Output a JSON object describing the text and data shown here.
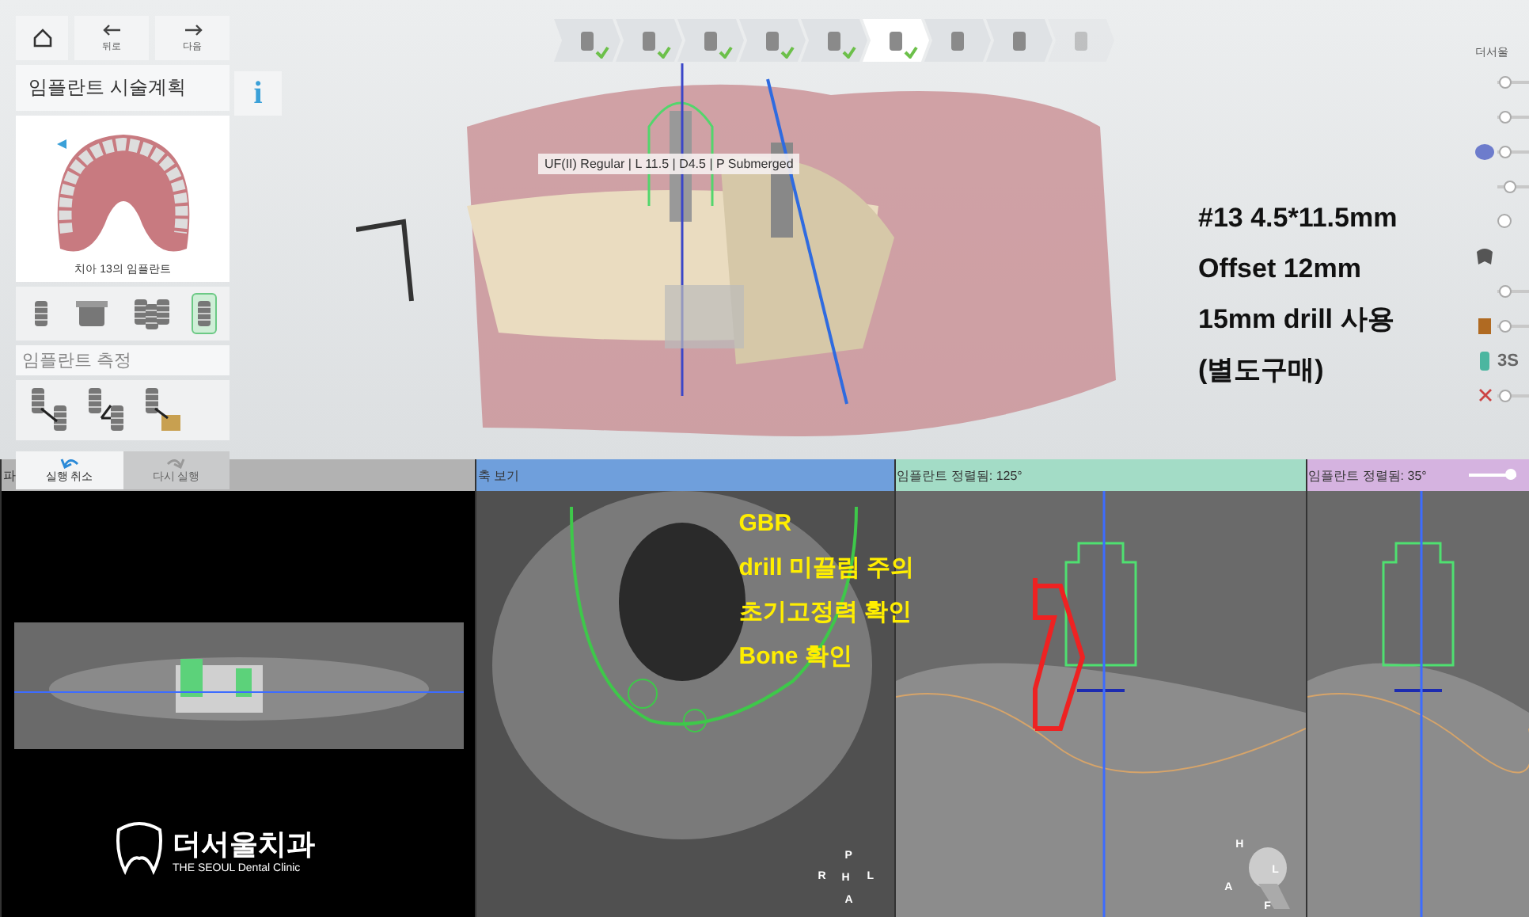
{
  "nav": {
    "back": "뒤로",
    "next": "다음",
    "info": "i"
  },
  "plan_panel": {
    "title": "임플란트 시술계획",
    "caption": "치아 13의 임플란트",
    "tools": [
      {
        "kind": "implant",
        "selected": false
      },
      {
        "kind": "cylinder",
        "selected": false
      },
      {
        "kind": "multi",
        "selected": false
      },
      {
        "kind": "implant",
        "selected": true
      }
    ],
    "measure_title": "임플란트 측정",
    "measures": [
      {
        "kind": "distance"
      },
      {
        "kind": "angle"
      },
      {
        "kind": "bone"
      }
    ],
    "undo": {
      "label": "실행 취소",
      "disabled": false
    },
    "redo": {
      "label": "다시 실행",
      "disabled": true
    }
  },
  "steps": [
    {
      "checked": true,
      "selected": false,
      "disabled": false
    },
    {
      "checked": true,
      "selected": false,
      "disabled": false
    },
    {
      "checked": true,
      "selected": false,
      "disabled": false
    },
    {
      "checked": true,
      "selected": false,
      "disabled": false
    },
    {
      "checked": true,
      "selected": false,
      "disabled": false
    },
    {
      "checked": true,
      "selected": true,
      "disabled": false
    },
    {
      "checked": false,
      "selected": false,
      "disabled": false
    },
    {
      "checked": false,
      "selected": false,
      "disabled": false
    },
    {
      "checked": false,
      "selected": false,
      "disabled": true
    }
  ],
  "tooltip": "UF(II) Regular | L 11.5 | D4.5 | P Submerged",
  "notes": [
    "#13 4.5*11.5mm",
    "Offset 12mm",
    "15mm drill 사용",
    "(별도구매)"
  ],
  "layers_panel": {
    "title": "더서울",
    "badge": "3S",
    "layers": [
      {
        "kind": "slider",
        "level": 0.05
      },
      {
        "kind": "slider",
        "level": 0.05
      },
      {
        "kind": "slider",
        "level": 0.05
      },
      {
        "kind": "slider",
        "level": 0.3
      },
      {
        "kind": "toggle"
      },
      {
        "kind": "toggle"
      },
      {
        "kind": "slider",
        "level": 0.05
      },
      {
        "kind": "slider",
        "level": 0.05
      },
      {
        "kind": "toggle"
      },
      {
        "kind": "slider",
        "level": 0.05
      }
    ]
  },
  "views": [
    {
      "kind": "panoramic",
      "title": "파",
      "color": "#b2b2b2"
    },
    {
      "kind": "axial",
      "title": "축 보기",
      "color": "#6f9fdc",
      "notes": [
        "GBR",
        "drill 미끌림 주의",
        "초기고정력 확인",
        "Bone 확인"
      ],
      "orientation": [
        "P",
        "R",
        "H",
        "L",
        "A"
      ]
    },
    {
      "kind": "cross",
      "title": "임플란트 정렬됨: 125°",
      "color": "#a3dcc6",
      "head_labels": [
        "H",
        "L",
        "A",
        "F"
      ]
    },
    {
      "kind": "cross",
      "title": "임플란트 정렬됨: 35°",
      "color": "#d5b3e0",
      "level": 0.85
    }
  ],
  "logo": {
    "name": "더서울치과",
    "subtitle": "THE SEOUL Dental Clinic"
  }
}
